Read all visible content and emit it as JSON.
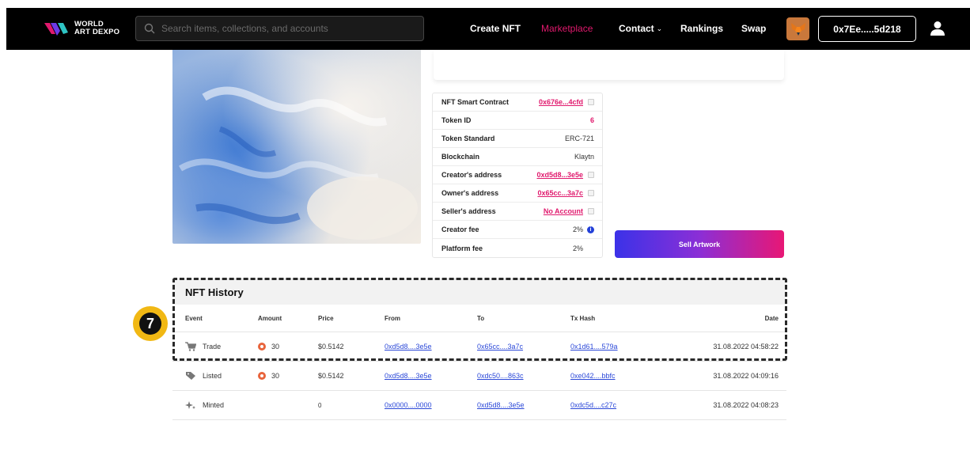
{
  "navbar": {
    "logo_line1": "WORLD",
    "logo_line2": "ART DEXPO",
    "search_placeholder": "Search items, collections, and accounts",
    "items": {
      "create": "Create NFT",
      "marketplace": "Marketplace",
      "contact": "Contact",
      "contact_caret": "⌄",
      "rankings": "Rankings",
      "swap": "Swap"
    },
    "wallet_address": "0x7Ee.....5d218",
    "accent_color": "#e0196d"
  },
  "info": {
    "rows": [
      {
        "key": "NFT Smart Contract",
        "value": "0x676e...4cfd"
      },
      {
        "key": "Token ID",
        "value": "6"
      },
      {
        "key": "Token Standard",
        "value": "ERC-721"
      },
      {
        "key": "Blockchain",
        "value": "Klaytn"
      },
      {
        "key": "Creator's address",
        "value": "0xd5d8...3e5e"
      },
      {
        "key": "Owner's address",
        "value": "0x65cc...3a7c"
      },
      {
        "key": "Seller's address",
        "value": "No Account"
      },
      {
        "key": "Creator fee",
        "value": "2%"
      },
      {
        "key": "Platform fee",
        "value": "2%"
      }
    ],
    "info_icon": "i"
  },
  "sell_button": "Sell Artwork",
  "history": {
    "title": "NFT History",
    "columns": [
      "Event",
      "Amount",
      "Price",
      "From",
      "To",
      "Tx Hash",
      "Date"
    ],
    "rows": [
      {
        "event": "Trade",
        "event_icon": "cart-icon",
        "amount": "30",
        "price": "$0.5142",
        "from": "0xd5d8....3e5e",
        "to": "0x65cc....3a7c",
        "tx": "0x1d61....579a",
        "date": "31.08.2022 04:58:22"
      },
      {
        "event": "Listed",
        "event_icon": "tag-icon",
        "amount": "30",
        "price": "$0.5142",
        "from": "0xd5d8....3e5e",
        "to": "0xdc50....863c",
        "tx": "0xe042....bbfc",
        "date": "31.08.2022 04:09:16"
      },
      {
        "event": "Minted",
        "event_icon": "sparkle-icon",
        "amount": "",
        "price": "0",
        "from": "0x0000....0000",
        "to": "0xd5d8....3e5e",
        "tx": "0xdc5d....c27c",
        "date": "31.08.2022 04:08:23"
      }
    ]
  },
  "step_badge": "7",
  "colors": {
    "highlight_badge": "#f1b814",
    "link": "#2b48d8"
  }
}
